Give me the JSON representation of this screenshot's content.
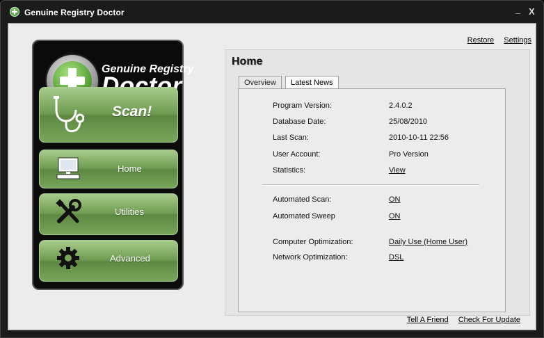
{
  "window": {
    "title": "Genuine Registry Doctor",
    "minimize_label": "_",
    "close_label": "X"
  },
  "top_links": {
    "restore": "Restore",
    "settings": "Settings"
  },
  "brand": {
    "line1": "Genuine Registry",
    "line2": "Doctor"
  },
  "nav": {
    "scan": "Scan!",
    "home": "Home",
    "utilities": "Utilities",
    "advanced": "Advanced"
  },
  "page": {
    "title": "Home",
    "tabs": [
      {
        "label": "Overview"
      },
      {
        "label": "Latest News"
      }
    ]
  },
  "info": {
    "program_version": {
      "label": "Program Version:",
      "value": "2.4.0.2"
    },
    "database_date": {
      "label": "Database Date:",
      "value": "25/08/2010"
    },
    "last_scan": {
      "label": "Last Scan:",
      "value": "2010-10-11 22:56"
    },
    "user_account": {
      "label": "User Account:",
      "value": "Pro Version"
    },
    "statistics": {
      "label": "Statistics:",
      "value": "View"
    },
    "automated_scan": {
      "label": "Automated Scan:",
      "value": "ON"
    },
    "automated_sweep": {
      "label": "Automated Sweep",
      "value": "ON"
    },
    "computer_optimization": {
      "label": "Computer Optimization:",
      "value": "Daily Use (Home User)"
    },
    "network_optimization": {
      "label": "Network Optimization:",
      "value": "DSL"
    }
  },
  "bottom_links": {
    "tell_friend": "Tell A Friend",
    "check_update": "Check For Update"
  },
  "colors": {
    "accent_green": "#6e9b50",
    "sidebar_bg": "#0b0b0b",
    "window_bg": "#1b1b1b"
  },
  "icons": [
    "stethoscope-icon",
    "computer-icon",
    "tools-icon",
    "gear-icon"
  ]
}
